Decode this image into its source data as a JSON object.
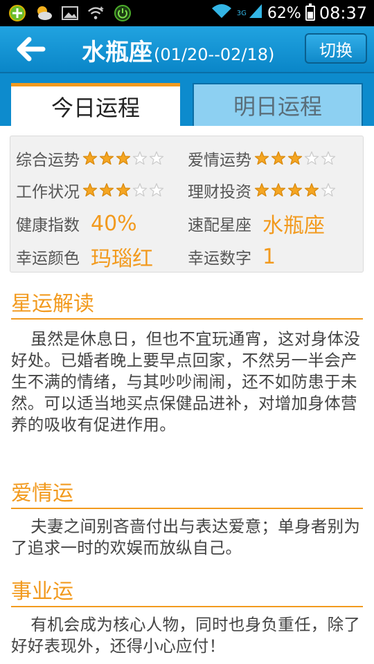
{
  "status_bar": {
    "battery": "62%",
    "time": "08:37",
    "network": "3G",
    "left_icons": [
      "app-notification-icon",
      "weather-icon",
      "gallery-icon",
      "wifi-plus-icon",
      "power-icon"
    ]
  },
  "appbar": {
    "title": "水瓶座",
    "date_range": "(01/20--02/18)",
    "switch_label": "切换"
  },
  "tabs": [
    {
      "label": "今日运程",
      "active": true
    },
    {
      "label": "明日运程",
      "active": false
    }
  ],
  "summary": {
    "overall": {
      "label": "综合运势",
      "stars": 3,
      "max": 5
    },
    "love": {
      "label": "爱情运势",
      "stars": 3,
      "max": 5
    },
    "work": {
      "label": "工作状况",
      "stars": 3,
      "max": 5
    },
    "finance": {
      "label": "理财投资",
      "stars": 4,
      "max": 5
    },
    "health": {
      "label": "健康指数",
      "value": "40%"
    },
    "match": {
      "label": "速配星座",
      "value": "水瓶座"
    },
    "lucky_color": {
      "label": "幸运颜色",
      "value": "玛瑙红"
    },
    "lucky_number": {
      "label": "幸运数字",
      "value": "1"
    }
  },
  "sections": {
    "reading": {
      "title": "星运解读",
      "body": "虽然是休息日，但也不宜玩通宵，这对身体没好处。已婚者晚上要早点回家，不然另一半会产生不满的情绪，与其吵吵闹闹，还不如防患于未然。可以适当地买点保健品进补，对增加身体营养的吸收有促进作用。"
    },
    "love": {
      "title": "爱情运",
      "body": "夫妻之间别吝啬付出与表达爱意；单身者别为了追求一时的欢娱而放纵自己。"
    },
    "career": {
      "title": "事业运",
      "body": "有机会成为核心人物，同时也身负重任，除了好好表现外，还得小心应付！"
    }
  },
  "colors": {
    "accent": "#f29a1e",
    "appbar": "#1496d6",
    "star_filled": "#f5a623",
    "star_empty": "#cccccc"
  }
}
